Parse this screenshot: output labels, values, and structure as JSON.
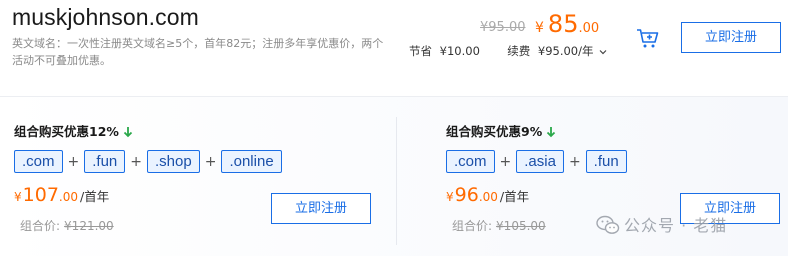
{
  "domain": {
    "name": "muskjohnson.com",
    "description": "英文域名：一次性注册英文域名≥5个，首年82元；注册多年享优惠价，两个活动不可叠加优惠。"
  },
  "pricing": {
    "old_price": "¥95.00",
    "currency": "¥",
    "price_int": "85",
    "price_dec": ".00",
    "save_label": "节省",
    "save_value": "¥10.00",
    "renew_label": "续费",
    "renew_value": "¥95.00/年",
    "register_label": "立即注册"
  },
  "combos": [
    {
      "title": "组合购买优惠12%",
      "tlds": [
        ".com",
        ".fun",
        ".shop",
        ".online"
      ],
      "currency": "¥",
      "price_int": "107",
      "price_dec": ".00",
      "unit": "/首年",
      "combo_label": "组合价:",
      "combo_old": "¥121.00",
      "register_label": "立即注册"
    },
    {
      "title": "组合购买优惠9%",
      "tlds": [
        ".com",
        ".asia",
        ".fun"
      ],
      "currency": "¥",
      "price_int": "96",
      "price_dec": ".00",
      "unit": "/首年",
      "combo_label": "组合价:",
      "combo_old": "¥105.00",
      "register_label": "立即注册"
    }
  ],
  "plus_sign": "+",
  "watermark": "公众号 · 老猫",
  "colors": {
    "accent": "#1a6ee6",
    "price": "#ff6a00",
    "green_arrow": "#2aa84a"
  }
}
